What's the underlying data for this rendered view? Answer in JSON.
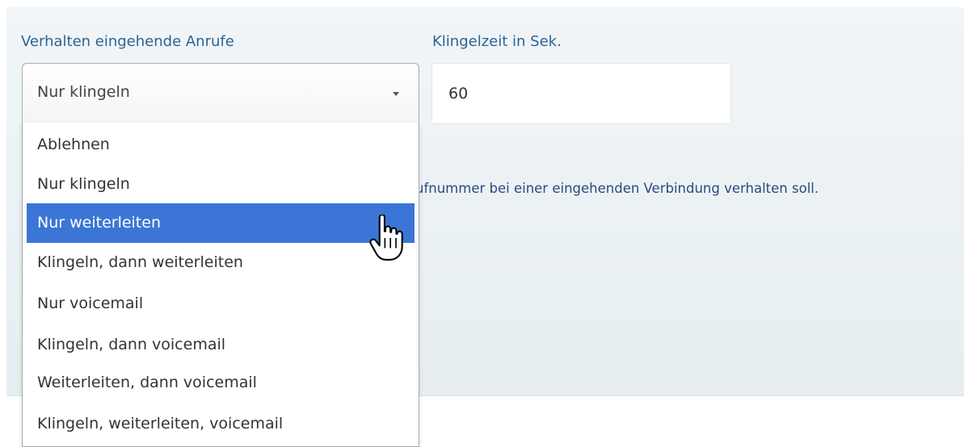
{
  "form": {
    "behavior": {
      "label": "Verhalten eingehende Anrufe",
      "selected": "Nur klingeln",
      "highlighted_index": 2,
      "options": [
        "Ablehnen",
        "Nur klingeln",
        "Nur weiterleiten",
        "Klingeln, dann weiterleiten",
        "Nur voicemail",
        "Klingeln, dann voicemail",
        "Weiterleiten, dann voicemail",
        "Klingeln, weiterleiten, voicemail"
      ]
    },
    "ring_time": {
      "label": "Klingelzeit in Sek.",
      "value": "60"
    },
    "help_text": "ufnummer bei einer eingehenden Verbindung verhalten soll."
  },
  "colors": {
    "label": "#2a6496",
    "highlight": "#3b76d6",
    "panel_background": "#eaf0f3"
  },
  "icons": {
    "dropdown_arrow": "caret-down-icon",
    "pointer": "hand-pointer-icon"
  }
}
